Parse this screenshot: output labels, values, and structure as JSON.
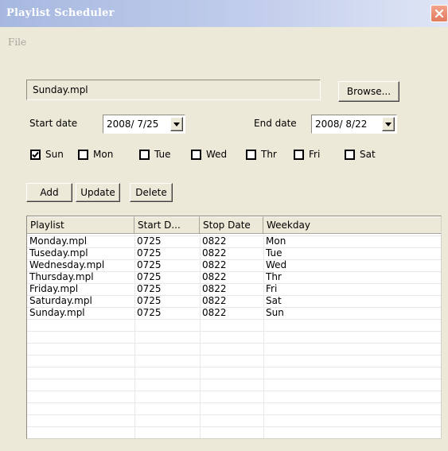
{
  "window": {
    "title": "Playlist Scheduler",
    "close_icon": "close-icon"
  },
  "menu": {
    "file": "File"
  },
  "file": {
    "name": "Sunday.mpl",
    "browse_label": "Browse..."
  },
  "dates": {
    "start_label": "Start date",
    "start_value": "2008/ 7/25",
    "end_label": "End date",
    "end_value": "2008/ 8/22"
  },
  "days": [
    {
      "label": "Sun",
      "checked": true
    },
    {
      "label": "Mon",
      "checked": false
    },
    {
      "label": "Tue",
      "checked": false
    },
    {
      "label": "Wed",
      "checked": false
    },
    {
      "label": "Thr",
      "checked": false
    },
    {
      "label": "Fri",
      "checked": false
    },
    {
      "label": "Sat",
      "checked": false
    }
  ],
  "actions": {
    "add": "Add",
    "update": "Update",
    "delete": "Delete"
  },
  "table": {
    "columns": [
      "Playlist",
      "Start D...",
      "Stop Date",
      "Weekday"
    ],
    "rows": [
      [
        "Monday.mpl",
        "0725",
        "0822",
        "Mon"
      ],
      [
        "Tuseday.mpl",
        "0725",
        "0822",
        "Tue"
      ],
      [
        "Wednesday.mpl",
        "0725",
        "0822",
        "Wed"
      ],
      [
        "Thursday.mpl",
        "0725",
        "0822",
        "Thr"
      ],
      [
        "Friday.mpl",
        "0725",
        "0822",
        "Fri"
      ],
      [
        "Saturday.mpl",
        "0725",
        "0822",
        "Sat"
      ],
      [
        "Sunday.mpl",
        "0725",
        "0822",
        "Sun"
      ]
    ]
  }
}
